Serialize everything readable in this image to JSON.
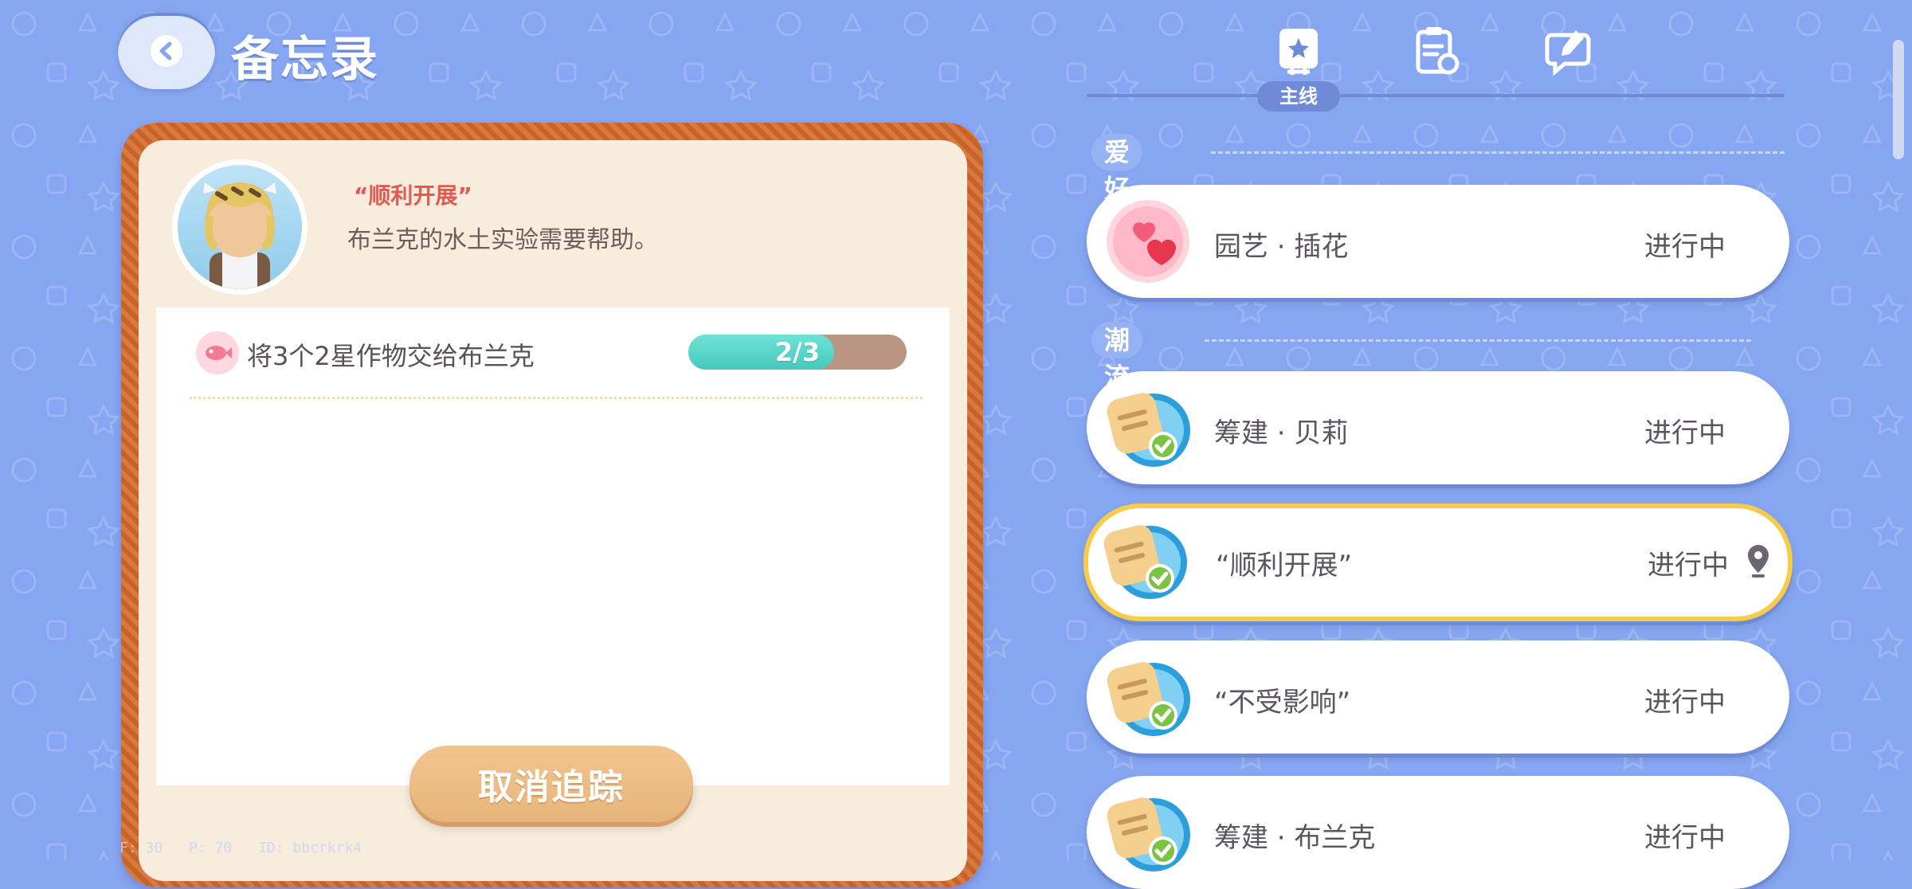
{
  "header": {
    "title": "备忘录"
  },
  "tabs": [
    {
      "id": "main",
      "label": "主线",
      "icon": "book-star-icon",
      "active": true
    },
    {
      "id": "tasks",
      "icon": "clipboard-refresh-icon",
      "active": false
    },
    {
      "id": "notes",
      "icon": "speech-edit-icon",
      "active": false
    }
  ],
  "quest_detail": {
    "name": "“顺利开展”",
    "description": "布兰克的水土实验需要帮助。",
    "task": {
      "text": "将3个2星作物交给布兰克",
      "progress_label": "2/3",
      "progress_fraction": 0.667
    },
    "cancel_label": "取消追踪"
  },
  "sections": [
    {
      "title": "爱好引导",
      "items": [
        {
          "title": "园艺 · 插花",
          "status": "进行中",
          "icon": "heart-bubble-icon",
          "selected": false
        }
      ]
    },
    {
      "title": "潮流季",
      "items": [
        {
          "title": "筹建 · 贝莉",
          "status": "进行中",
          "icon": "memo-check-icon",
          "selected": false
        },
        {
          "title": "“顺利开展”",
          "status": "进行中",
          "icon": "memo-check-icon",
          "selected": true,
          "tracked": true
        },
        {
          "title": "“不受影响”",
          "status": "进行中",
          "icon": "memo-check-icon",
          "selected": false
        },
        {
          "title": "筹建 · 布兰克",
          "status": "进行中",
          "icon": "memo-check-icon",
          "selected": false
        }
      ]
    }
  ],
  "debug": {
    "f": "F: 30",
    "p": "P: 70",
    "id": "ID: bbcrkrk4"
  },
  "colors": {
    "background": "#86a6f1",
    "accent": "#6f8ad7",
    "highlight": "#f7cc4a",
    "progress": "#45c9bd",
    "frame": "#c9612b"
  }
}
